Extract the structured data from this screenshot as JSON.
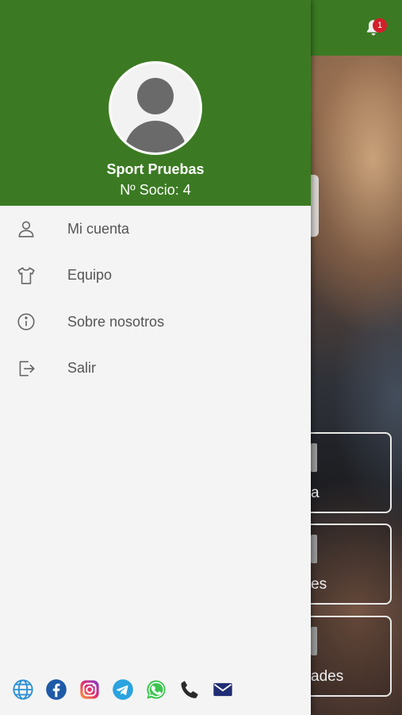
{
  "notifications": {
    "badge_count": "1",
    "icon": "bell-icon"
  },
  "drawer": {
    "user_name": "Sport Pruebas",
    "member_number": "Nº Socio: 4",
    "menu": [
      {
        "label": "Mi cuenta",
        "icon": "user-icon"
      },
      {
        "label": "Equipo",
        "icon": "shirt-icon"
      },
      {
        "label": "Sobre nosotros",
        "icon": "info-icon"
      },
      {
        "label": "Salir",
        "icon": "logout-icon"
      }
    ],
    "social_icons": [
      "globe-icon",
      "facebook-icon",
      "instagram-icon",
      "telegram-icon",
      "whatsapp-icon",
      "phone-icon",
      "mail-icon"
    ]
  },
  "background": {
    "cards": [
      "a",
      "es",
      "ades"
    ]
  },
  "colors": {
    "header_green": "#3b7a22",
    "drawer_bg": "#f4f4f4",
    "badge_red": "#d21f2b"
  }
}
